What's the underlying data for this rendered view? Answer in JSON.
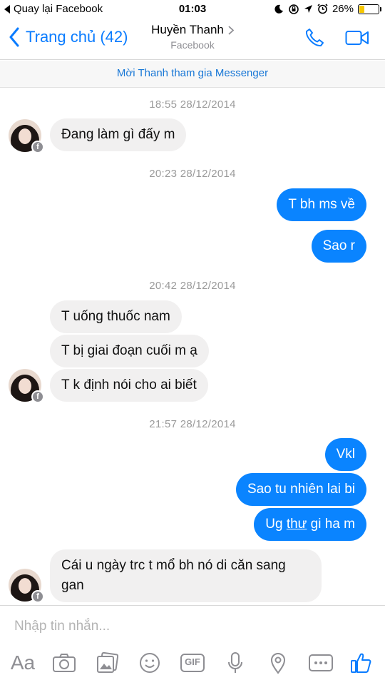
{
  "status_bar": {
    "back_app": "Quay lại Facebook",
    "time": "01:03",
    "battery": "26%",
    "battery_level": 0.26
  },
  "nav": {
    "back_label": "Trang chủ (42)",
    "contact_name": "Huyền Thanh",
    "contact_source": "Facebook"
  },
  "invite_banner": "Mời Thanh tham gia Messenger",
  "messages": {
    "ts1": "18:55 28/12/2014",
    "m1": "Đang làm gì đấy m",
    "ts2": "20:23 28/12/2014",
    "m2": "T bh ms về",
    "m3": "Sao r",
    "ts3": "20:42 28/12/2014",
    "m4": "T uống thuốc nam",
    "m5": "T bị giai đoạn cuối m ạ",
    "m6": "T k định nói cho ai biết",
    "ts4": "21:57 28/12/2014",
    "m7": "Vkl",
    "m8": "Sao tu nhiên lai bi",
    "m9_a": "Ug ",
    "m9_b": "thư",
    "m9_c": " gi ha m",
    "m10": "Cái u ngày trc t mổ bh nó di căn sang gan"
  },
  "composer": {
    "placeholder": "Nhập tin nhắn...",
    "aa_label": "Aa",
    "gif_label": "GIF"
  },
  "colors": {
    "accent": "#0a7cff",
    "outgoing_bubble": "#0a84ff",
    "incoming_bubble": "#f1f0f0"
  }
}
